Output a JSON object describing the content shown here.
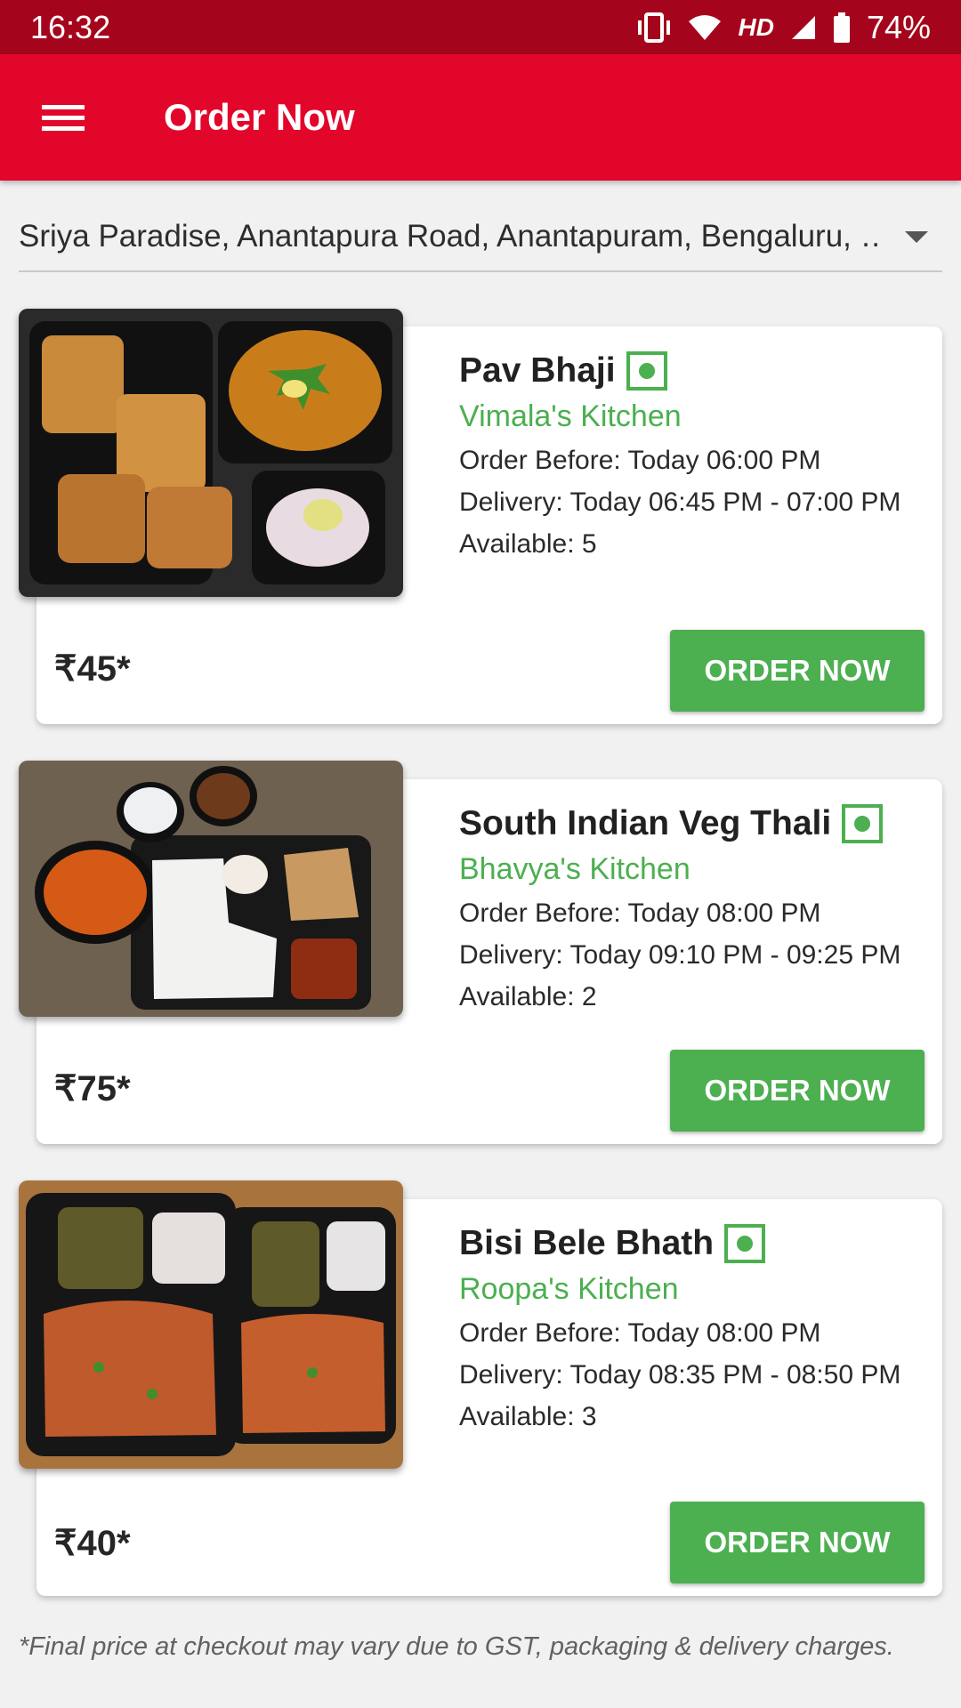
{
  "status_bar": {
    "time": "16:32",
    "network": "HD",
    "battery": "74%"
  },
  "app_bar": {
    "title": "Order Now",
    "menu_icon": "hamburger-menu-icon"
  },
  "address": {
    "value": "Sriya Paradise, Anantapura Road, Anantapuram, Bengaluru, …"
  },
  "items": [
    {
      "name": "Pav Bhaji",
      "kitchen": "Vimala's Kitchen",
      "order_before": "Order Before: Today 06:00 PM",
      "delivery": "Delivery: Today 06:45 PM - 07:00 PM",
      "available": "Available: 5",
      "price": "₹45*",
      "button": "ORDER NOW"
    },
    {
      "name": "South Indian Veg Thali",
      "kitchen": "Bhavya's Kitchen",
      "order_before": "Order Before: Today 08:00 PM",
      "delivery": "Delivery: Today 09:10 PM - 09:25 PM",
      "available": "Available: 2",
      "price": "₹75*",
      "button": "ORDER NOW"
    },
    {
      "name": "Bisi Bele Bhath",
      "kitchen": "Roopa's Kitchen",
      "order_before": "Order Before: Today 08:00 PM",
      "delivery": "Delivery: Today 08:35 PM - 08:50 PM",
      "available": "Available: 3",
      "price": "₹40*",
      "button": "ORDER NOW"
    }
  ],
  "footnote": "*Final price at checkout may vary due to GST, packaging & delivery charges.",
  "colors": {
    "status_bar": "#a5051c",
    "app_bar": "#e2062a",
    "accent_green": "#4caf50"
  }
}
